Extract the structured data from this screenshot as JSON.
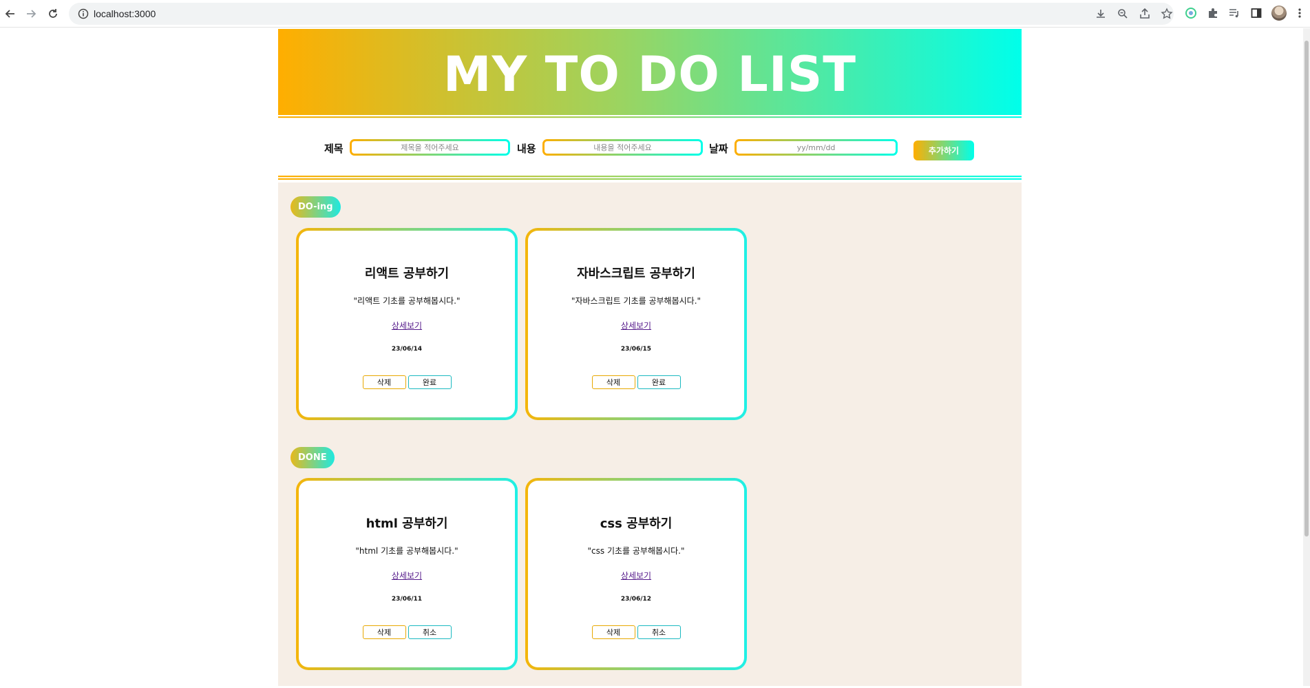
{
  "browser": {
    "url": "localhost:3000"
  },
  "header": {
    "title": "MY TO DO LIST"
  },
  "form": {
    "title_label": "제목",
    "title_placeholder": "제목을 적어주세요",
    "content_label": "내용",
    "content_placeholder": "내용을 적어주세요",
    "date_label": "날짜",
    "date_placeholder": "yy/mm/dd",
    "add_label": "추가하기"
  },
  "sections": {
    "doing": {
      "label": "DO-ing",
      "cards": [
        {
          "title": "리액트 공부하기",
          "desc": "\"리액트 기초를 공부해봅시다.\"",
          "link": "상세보기",
          "date": "23/06/14",
          "delete_label": "삭제",
          "toggle_label": "완료"
        },
        {
          "title": "자바스크립트 공부하기",
          "desc": "\"자바스크립트 기초를 공부해봅시다.\"",
          "link": "상세보기",
          "date": "23/06/15",
          "delete_label": "삭제",
          "toggle_label": "완료"
        }
      ]
    },
    "done": {
      "label": "DONE",
      "cards": [
        {
          "title": "html 공부하기",
          "desc": "\"html 기초를 공부해봅시다.\"",
          "link": "상세보기",
          "date": "23/06/11",
          "delete_label": "삭제",
          "toggle_label": "취소"
        },
        {
          "title": "css 공부하기",
          "desc": "\"css 기초를 공부해봅시다.\"",
          "link": "상세보기",
          "date": "23/06/12",
          "delete_label": "삭제",
          "toggle_label": "취소"
        }
      ]
    }
  },
  "colors": {
    "gradient_start": "#ffae00",
    "gradient_end": "#00ffea",
    "board_bg": "#f6eee6"
  },
  "icons": [
    "back-icon",
    "forward-icon",
    "reload-icon",
    "info-icon",
    "download-icon",
    "zoom-icon",
    "share-icon",
    "star-icon",
    "extension-icon",
    "puzzle-icon",
    "media-icon",
    "sidepanel-icon",
    "avatar",
    "menu-icon"
  ]
}
